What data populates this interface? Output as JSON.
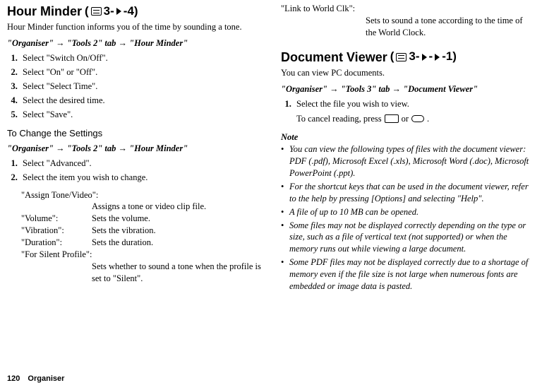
{
  "left": {
    "title": "Hour Minder",
    "menu_code": "3-",
    "menu_suffix": "-4)",
    "intro": "Hour Minder function informs you of the time by sounding a tone.",
    "path": "\"Organiser\" → \"Tools 2\" tab → \"Hour Minder\"",
    "steps1": [
      "Select \"Switch On/Off\".",
      "Select \"On\" or \"Off\".",
      "Select \"Select Time\".",
      "Select the desired time.",
      "Select \"Save\"."
    ],
    "subhead": "To Change the Settings",
    "path2": "\"Organiser\" → \"Tools 2\" tab → \"Hour Minder\"",
    "steps2": [
      "Select \"Advanced\".",
      "Select the item you wish to change."
    ],
    "defs_lead": "\"Assign Tone/Video\":",
    "defs_lead_desc": "Assigns a tone or video clip file.",
    "defs": [
      {
        "term": "\"Volume\":",
        "desc": "Sets the volume."
      },
      {
        "term": "\"Vibration\":",
        "desc": "Sets the vibration."
      },
      {
        "term": "\"Duration\":",
        "desc": "Sets the duration."
      }
    ],
    "silent_term": "\"For Silent Profile\":",
    "silent_desc": "Sets whether to sound a tone when the profile is set to \"Silent\"."
  },
  "right_top": {
    "term": "\"Link to World Clk\":",
    "desc": "Sets to sound a tone according to the time of the World Clock."
  },
  "right": {
    "title": "Document Viewer",
    "menu_code": "3-",
    "menu_suffix": "-1)",
    "intro": "You can view PC documents.",
    "path": "\"Organiser\" → \"Tools 3\" tab → \"Document Viewer\"",
    "step1": "Select the file you wish to view.",
    "cancel_pre": "To cancel reading, press ",
    "cancel_mid": " or ",
    "cancel_post": ".",
    "note_head": "Note",
    "notes": [
      "You can view the following types of files with the document viewer: PDF (.pdf), Microsoft Excel (.xls), Microsoft Word (.doc), Microsoft PowerPoint (.ppt).",
      "For the shortcut keys that can be used in the document viewer, refer to the help by pressing [Options] and selecting \"Help\".",
      "A file of up to 10 MB can be opened.",
      "Some files may not be displayed correctly depending on the type or size, such as a file of vertical text (not supported) or when the memory runs out while viewing a large document.",
      "Some PDF files may not be displayed correctly due to a shortage of memory even if the file size is not large when numerous fonts are embedded or image data is pasted."
    ]
  },
  "footer": {
    "page": "120",
    "section": "Organiser"
  }
}
